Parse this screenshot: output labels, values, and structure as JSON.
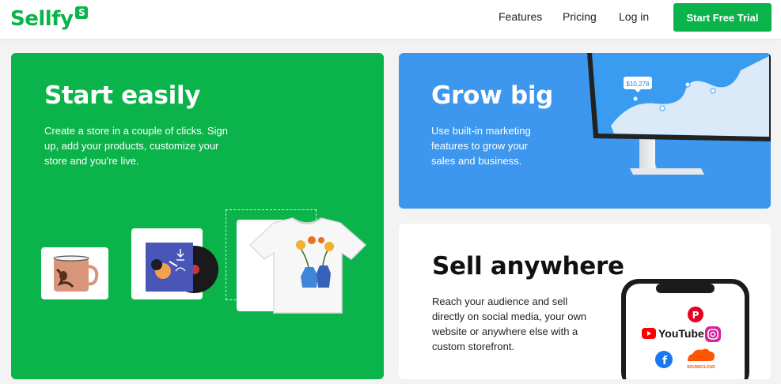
{
  "header": {
    "logo_text": "Sellfy",
    "logo_badge": "S",
    "nav": {
      "features": "Features",
      "pricing": "Pricing",
      "login": "Log in"
    },
    "cta_label": "Start Free Trial"
  },
  "cards": {
    "start": {
      "title": "Start easily",
      "description": "Create a store in a couple of clicks. Sign up, add your products, customize your store and you're live."
    },
    "grow": {
      "title": "Grow big",
      "description": "Use built-in marketing features to grow your sales and business.",
      "chart_badge": "$10,278"
    },
    "sell": {
      "title": "Sell anywhere",
      "description": "Reach your audience and sell directly on social media, your own website or anywhere else with a custom storefront.",
      "platforms": {
        "youtube": "YouTube",
        "soundcloud": "SOUNDCLOUD"
      }
    }
  },
  "colors": {
    "brand_green": "#0bb44a",
    "blue": "#3d97ee",
    "background": "#f3f3f3"
  }
}
